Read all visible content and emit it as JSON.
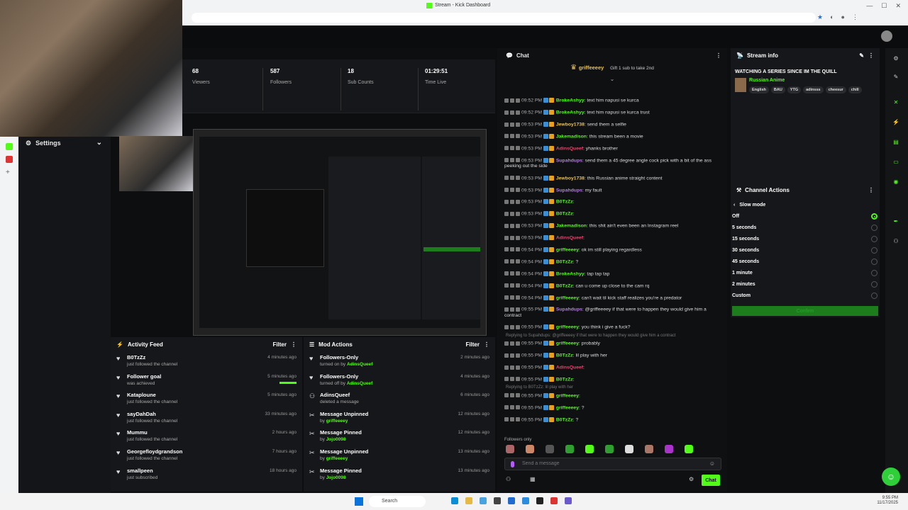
{
  "browser": {
    "tab_title": "Stream - Kick Dashboard"
  },
  "stats": [
    {
      "value": "68",
      "label": "Viewers"
    },
    {
      "value": "587",
      "label": "Followers"
    },
    {
      "value": "18",
      "label": "Sub Counts"
    },
    {
      "value": "01:29:51",
      "label": "Time Live"
    }
  ],
  "settings": {
    "title": "Settings"
  },
  "activity": {
    "title": "Activity Feed",
    "filter": "Filter",
    "items": [
      {
        "name": "B0TzZz",
        "sub": "just followed the channel",
        "time": "4 minutes ago"
      },
      {
        "name": "Follower goal",
        "sub": "was achieved",
        "time": "5 minutes ago"
      },
      {
        "name": "Kataploune",
        "sub": "just followed the channel",
        "time": "5 minutes ago"
      },
      {
        "name": "sayDahDah",
        "sub": "just followed the channel",
        "time": "33 minutes ago"
      },
      {
        "name": "Mummu",
        "sub": "just followed the channel",
        "time": "2 hours ago"
      },
      {
        "name": "Georgefloydgrandson",
        "sub": "just followed the channel",
        "time": "7 hours ago"
      },
      {
        "name": "smallpeen",
        "sub": "just subscribed",
        "time": "18 hours ago"
      }
    ]
  },
  "mod": {
    "title": "Mod Actions",
    "filter": "Filter",
    "items": [
      {
        "name": "Followers-Only",
        "sub": "turned on by",
        "by": "AdinsQueef",
        "time": "2 minutes ago"
      },
      {
        "name": "Followers-Only",
        "sub": "turned off by",
        "by": "AdinsQueef",
        "time": "4 minutes ago"
      },
      {
        "name": "AdinsQueef",
        "sub": "deleted a message",
        "by": "",
        "time": "6 minutes ago"
      },
      {
        "name": "Message Unpinned",
        "sub": "by",
        "by": "griffeeeey",
        "time": "12 minutes ago"
      },
      {
        "name": "Message Pinned",
        "sub": "by",
        "by": "Jojo0098",
        "time": "12 minutes ago"
      },
      {
        "name": "Message Unpinned",
        "sub": "by",
        "by": "griffeeeey",
        "time": "13 minutes ago"
      },
      {
        "name": "Message Pinned",
        "sub": "by",
        "by": "Jojo0098",
        "time": "13 minutes ago"
      }
    ]
  },
  "chat": {
    "title": "Chat",
    "pinned_user": "griffeeeey",
    "pinned_gift": "Gift 1 sub to take 2nd",
    "messages": [
      {
        "time": "09:52 PM",
        "user": "BrokeAshyy",
        "color": "#53fc18",
        "text": ": text him napusi se kurca"
      },
      {
        "time": "09:52 PM",
        "user": "BrokeAshyy",
        "color": "#53fc18",
        "text": ": text him napusi se kurca trust"
      },
      {
        "time": "09:53 PM",
        "user": "Jewboy1738",
        "color": "#e8c15a",
        "text": ": send them a selfie"
      },
      {
        "time": "09:53 PM",
        "user": "Jakemadison",
        "color": "#53fc18",
        "text": ": this stream been a movie"
      },
      {
        "time": "09:53 PM",
        "user": "AdinsQueef",
        "color": "#ff3b6b",
        "text": ": yhanks brother"
      },
      {
        "time": "09:53 PM",
        "user": "Supahdups",
        "color": "#c073ff",
        "text": ": send them a 45 degree angle cock pick with a bit of the ass peeking out the side"
      },
      {
        "time": "09:53 PM",
        "user": "Jewboy1738",
        "color": "#e8c15a",
        "text": ": this Russian anime straight content"
      },
      {
        "time": "09:53 PM",
        "user": "Supahdups",
        "color": "#c073ff",
        "text": ": my fault"
      },
      {
        "time": "09:53 PM",
        "user": "B0TzZz",
        "color": "#53fc18",
        "text": ":"
      },
      {
        "time": "09:53 PM",
        "user": "B0TzZz",
        "color": "#53fc18",
        "text": ":"
      },
      {
        "time": "09:53 PM",
        "user": "Jakemadison",
        "color": "#53fc18",
        "text": ": this shit ain't even been an Instagram reel"
      },
      {
        "time": "09:53 PM",
        "user": "AdinsQueef",
        "color": "#ff3b6b",
        "text": ":"
      },
      {
        "time": "09:54 PM",
        "user": "griffeeeey",
        "color": "#53fc18",
        "text": ": ok im still playing regardless"
      },
      {
        "time": "09:54 PM",
        "user": "B0TzZz",
        "color": "#53fc18",
        "text": ": ?"
      },
      {
        "time": "09:54 PM",
        "user": "BrokeAshyy",
        "color": "#53fc18",
        "text": ": tap tap tap"
      },
      {
        "time": "09:54 PM",
        "user": "B0TzZz",
        "color": "#53fc18",
        "text": ": can u come up close to the cam rq"
      },
      {
        "time": "09:54 PM",
        "user": "griffeeeey",
        "color": "#53fc18",
        "text": ": can't wait til kick staff realizes you're a predator"
      },
      {
        "time": "09:55 PM",
        "user": "Supahdups",
        "color": "#c073ff",
        "text": ": @griffeeeey if that were to happen they would give him a contract"
      },
      {
        "time": "09:55 PM",
        "user": "griffeeeey",
        "color": "#53fc18",
        "text": ": you think i give a fuck?"
      },
      {
        "time": "09:55 PM",
        "user": "griffeeeey",
        "color": "#53fc18",
        "text": ": probably",
        "reply": "Replying to Supahdups: @griffeeeey if that were to happen they would give him a contract"
      },
      {
        "time": "09:55 PM",
        "user": "B0TzZz",
        "color": "#53fc18",
        "text": ": lil play with her"
      },
      {
        "time": "09:55 PM",
        "user": "AdinsQueef",
        "color": "#ff3b6b",
        "text": ":"
      },
      {
        "time": "09:55 PM",
        "user": "B0TzZz",
        "color": "#53fc18",
        "text": ":"
      },
      {
        "time": "09:55 PM",
        "user": "griffeeeey",
        "color": "#53fc18",
        "text": ":",
        "reply": "Replying to B0TzZz: lil play with her"
      },
      {
        "time": "09:55 PM",
        "user": "griffeeeey",
        "color": "#53fc18",
        "text": ": ?"
      },
      {
        "time": "09:55 PM",
        "user": "B0TzZz",
        "color": "#53fc18",
        "text": ": ?"
      }
    ],
    "followers_only": "Followers only",
    "placeholder": "Send a message",
    "send_label": "Chat"
  },
  "streaminfo": {
    "title": "Stream info",
    "stream_title": "WATCHING A SERIES SINCE IM THE QUILL",
    "category": "Russian Anime",
    "tags": [
      "English",
      "BAU",
      "YTG",
      "adinsss",
      "cheesur",
      "chill"
    ]
  },
  "channel_actions": {
    "title": "Channel Actions",
    "slow_mode": "Slow mode",
    "options": [
      "Off",
      "5 seconds",
      "15 seconds",
      "30 seconds",
      "45 seconds",
      "1 minute",
      "2 minutes",
      "Custom"
    ],
    "selected": "Off",
    "confirm": "Confirm"
  },
  "taskbar": {
    "search": "Search",
    "time": "9:55 PM",
    "date": "11/17/2025"
  }
}
